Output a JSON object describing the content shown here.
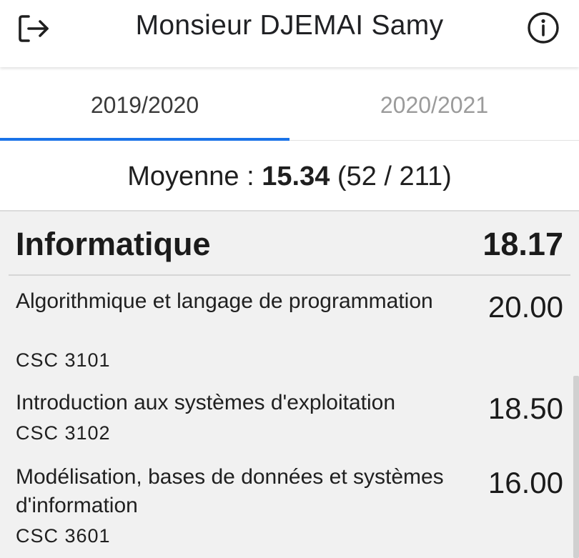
{
  "header": {
    "title": "Monsieur DJEMAI Samy",
    "logout_icon": "logout-icon",
    "info_icon": "info-icon"
  },
  "tabs": [
    {
      "label": "2019/2020",
      "active": true
    },
    {
      "label": "2020/2021",
      "active": false
    }
  ],
  "average": {
    "label": "Moyenne :",
    "value": "15.34",
    "rank": "(52 / 211)"
  },
  "unit": {
    "name": "Informatique",
    "score": "18.17",
    "courses": [
      {
        "name": "Algorithmique et langage de programmation",
        "code": "CSC  3101",
        "score": "20.00"
      },
      {
        "name": "Introduction aux systèmes d'exploitation",
        "code": "CSC  3102",
        "score": "18.50"
      },
      {
        "name": "Modélisation, bases de données et systèmes d'information",
        "code": "CSC  3601",
        "score": "16.00"
      }
    ]
  },
  "colors": {
    "accent": "#1a73e8",
    "panel_bg": "#f1f1f1"
  }
}
